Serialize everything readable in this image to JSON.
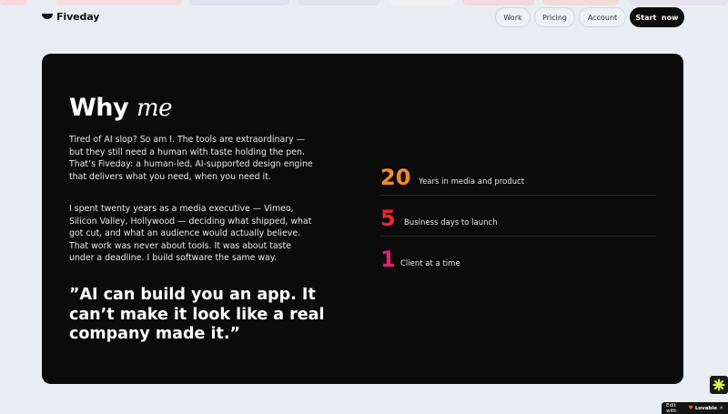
{
  "nav": {
    "brand": "Fiveday",
    "links": [
      "Work",
      "Pricing",
      "Account"
    ],
    "cta_start": "Start",
    "cta_now": "now"
  },
  "why": {
    "heading": "Why",
    "heading_italic": "me",
    "paragraphs": [
      "Tired of AI slop? So am I. The tools are extraordinary — but they still need a human with taste holding the pen. That’s Fiveday: a human-led, AI-supported design engine that delivers what you need, when you need it.",
      "I spent twenty years as a media executive — Vimeo, Silicon Valley, Hollywood — deciding what shipped, what got cut, and what an audience would actually believe. That work was never about tools. It was about taste under a deadline. I build software the same way."
    ],
    "quote": "”AI can build you an app. It can’t make it look like a real company made it.”"
  },
  "stats": [
    {
      "number": "20",
      "label": "Years in media and product",
      "color": "#f58a25"
    },
    {
      "number": "5",
      "label": "Business days to launch",
      "color": "#e8262e"
    },
    {
      "number": "1",
      "label": "Client at a time",
      "color": "#e61e6e"
    }
  ],
  "badge": {
    "prefix": "Edit with",
    "brand": "Lovable",
    "close": "×",
    "icon": "lovable-asterisk-icon"
  }
}
